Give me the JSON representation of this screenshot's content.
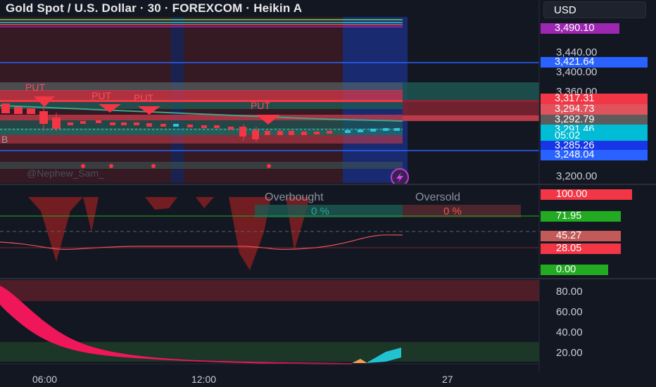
{
  "header": {
    "title": "Gold Spot / U.S. Dollar · 30 · FOREXCOM · Heikin A",
    "currency_button": "USD"
  },
  "price_axis": {
    "ticks": [
      "3,440.00",
      "3,400.00",
      "3,360.00",
      "3,200.00"
    ],
    "tags": [
      {
        "value": "3,490.10",
        "color": "#9c27b0"
      },
      {
        "value": "3,421.64",
        "color": "#2962ff"
      },
      {
        "value": "3,317.31",
        "color": "#f23645"
      },
      {
        "value": "3,294.73",
        "color": "#e0525c"
      },
      {
        "value": "3,292.79",
        "color": "#5d5b5b"
      },
      {
        "value": "3,291.46",
        "color": "#00bcd4"
      },
      {
        "value": "05:02",
        "color": "#00bcd4"
      },
      {
        "value": "3,285.26",
        "color": "#1636e8"
      },
      {
        "value": "3,248.04",
        "color": "#2962ff"
      }
    ]
  },
  "main_chart": {
    "signals": [
      "PUT",
      "PUT",
      "PUT",
      "PUT"
    ],
    "watermark": "@Nephew_Sam_",
    "left_label": "B"
  },
  "oscillator": {
    "overbought_label": "Overbought",
    "oversold_label": "Oversold",
    "overbought_pct": "0 %",
    "oversold_pct": "0 %",
    "tags": [
      {
        "value": "100.00",
        "color": "#f23645"
      },
      {
        "value": "71.95",
        "color": "#22ab22"
      },
      {
        "value": "45.27",
        "color": "#c25a5a"
      },
      {
        "value": "28.05",
        "color": "#f23645"
      },
      {
        "value": "0.00",
        "color": "#22ab22"
      }
    ]
  },
  "lower_panel": {
    "ticks": [
      "80.00",
      "60.00",
      "40.00",
      "20.00"
    ]
  },
  "time_axis": {
    "labels": [
      "06:00",
      "12:00",
      "27"
    ]
  }
}
